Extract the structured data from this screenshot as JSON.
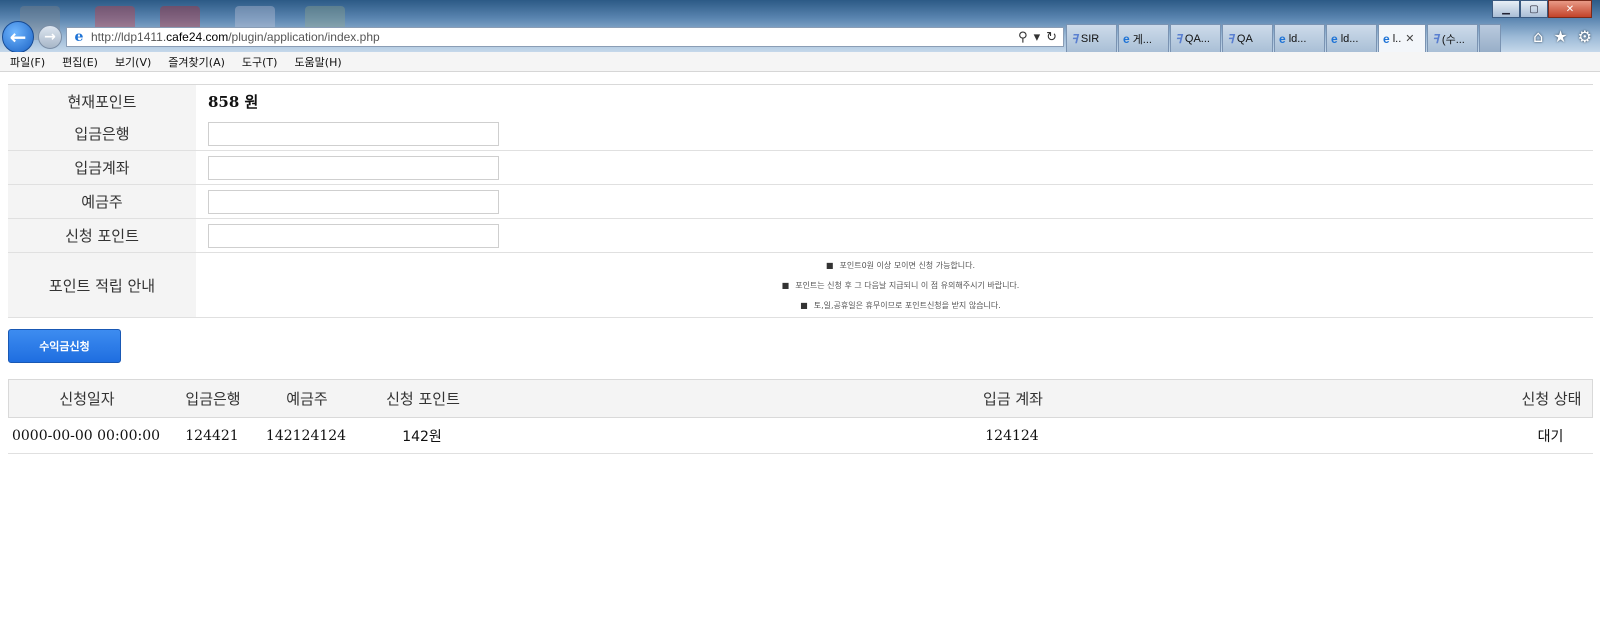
{
  "browser": {
    "url_prefix": "http://ldp1411.",
    "url_domain": "cafe24.com",
    "url_path": "/plugin/application/index.php",
    "search_icon": "search-icon",
    "tabs": [
      {
        "label": "SIR",
        "icon": "sir-icon"
      },
      {
        "label": "게...",
        "icon": "ie-icon"
      },
      {
        "label": "QA...",
        "icon": "sir-icon"
      },
      {
        "label": "QA",
        "icon": "sir-icon"
      },
      {
        "label": "ld...",
        "icon": "ie-icon"
      },
      {
        "label": "ld...",
        "icon": "ie-icon"
      },
      {
        "label": "l..",
        "icon": "ie-icon",
        "active": true
      },
      {
        "label": "(수...",
        "icon": "sir-icon"
      }
    ],
    "menu": [
      "파일(F)",
      "편집(E)",
      "보기(V)",
      "즐겨찾기(A)",
      "도구(T)",
      "도움말(H)"
    ]
  },
  "form": {
    "current_points_label": "현재포인트",
    "current_points_value": "858 원",
    "bank_label": "입금은행",
    "bank_value": "",
    "account_label": "입금계좌",
    "account_value": "",
    "holder_label": "예금주",
    "holder_value": "",
    "request_points_label": "신청 포인트",
    "request_points_value": "",
    "guide_label": "포인트 적립 안내",
    "guide_notes": [
      "포인트0원 이상 모이면 신청 가능합니다.",
      "포인트는 신청 후 그 다음날 지급되니 이 점 유의해주시기 바랍니다.",
      "토,일,공휴일은 휴무이므로 포인트신청을 받지 않습니다."
    ],
    "submit_label": "수익금신청"
  },
  "list": {
    "headers": [
      "신청일자",
      "입금은행",
      "예금주",
      "신청 포인트",
      "입금 계좌",
      "신청 상태"
    ],
    "rows": [
      [
        "0000-00-00 00:00:00",
        "124421",
        "142124124",
        "142원",
        "124124",
        "대기"
      ]
    ]
  },
  "colors": {
    "button_blue": "#2a7ae8",
    "label_bg": "#f4f4f4",
    "border": "#e0e0e0"
  }
}
